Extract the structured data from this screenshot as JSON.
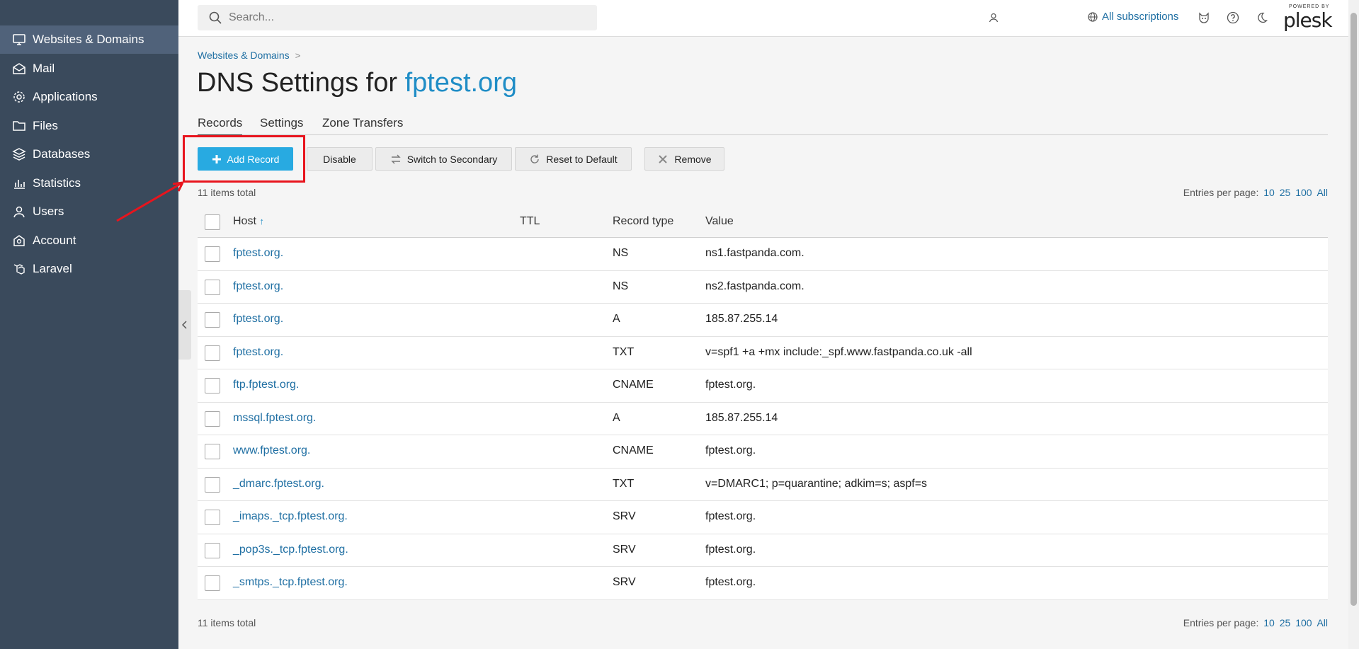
{
  "sidebar": {
    "items": [
      {
        "label": "Websites & Domains",
        "icon": "monitor-icon"
      },
      {
        "label": "Mail",
        "icon": "mail-icon"
      },
      {
        "label": "Applications",
        "icon": "gear-icon"
      },
      {
        "label": "Files",
        "icon": "folder-icon"
      },
      {
        "label": "Databases",
        "icon": "database-icon"
      },
      {
        "label": "Statistics",
        "icon": "bar-chart-icon"
      },
      {
        "label": "Users",
        "icon": "user-icon"
      },
      {
        "label": "Account",
        "icon": "account-icon"
      },
      {
        "label": "Laravel",
        "icon": "laravel-icon"
      }
    ]
  },
  "header": {
    "search_placeholder": "Search...",
    "subscriptions_label": "All subscriptions",
    "logo_powered": "POWERED BY",
    "logo_name": "plesk"
  },
  "breadcrumb": {
    "item": "Websites & Domains"
  },
  "page": {
    "title_prefix": "DNS Settings for",
    "domain": "fptest.org"
  },
  "tabs": [
    "Records",
    "Settings",
    "Zone Transfers"
  ],
  "toolbar": {
    "add": "Add Record",
    "disable": "Disable",
    "switch": "Switch to Secondary",
    "reset": "Reset to Default",
    "remove": "Remove"
  },
  "list_info": {
    "total": "11 items total",
    "per_page_label": "Entries per page:",
    "per_page_options": [
      "10",
      "25",
      "100",
      "All"
    ]
  },
  "table": {
    "columns": {
      "host": "Host",
      "sort_arrow": "↑",
      "ttl": "TTL",
      "type": "Record type",
      "value": "Value"
    },
    "rows": [
      {
        "host": "fptest.org.",
        "ttl": "",
        "type": "NS",
        "value": "ns1.fastpanda.com."
      },
      {
        "host": "fptest.org.",
        "ttl": "",
        "type": "NS",
        "value": "ns2.fastpanda.com."
      },
      {
        "host": "fptest.org.",
        "ttl": "",
        "type": "A",
        "value": "185.87.255.14"
      },
      {
        "host": "fptest.org.",
        "ttl": "",
        "type": "TXT",
        "value": "v=spf1 +a +mx include:_spf.www.fastpanda.co.uk -all"
      },
      {
        "host": "ftp.fptest.org.",
        "ttl": "",
        "type": "CNAME",
        "value": "fptest.org."
      },
      {
        "host": "mssql.fptest.org.",
        "ttl": "",
        "type": "A",
        "value": "185.87.255.14"
      },
      {
        "host": "www.fptest.org.",
        "ttl": "",
        "type": "CNAME",
        "value": "fptest.org."
      },
      {
        "host": "_dmarc.fptest.org.",
        "ttl": "",
        "type": "TXT",
        "value": "v=DMARC1; p=quarantine; adkim=s; aspf=s"
      },
      {
        "host": "_imaps._tcp.fptest.org.",
        "ttl": "",
        "type": "SRV",
        "value": "fptest.org."
      },
      {
        "host": "_pop3s._tcp.fptest.org.",
        "ttl": "",
        "type": "SRV",
        "value": "fptest.org."
      },
      {
        "host": "_smtps._tcp.fptest.org.",
        "ttl": "",
        "type": "SRV",
        "value": "fptest.org."
      }
    ]
  },
  "colors": {
    "sidebar": "#3a4a5c",
    "accent": "#28aae1",
    "link": "#1f6fa3",
    "highlight": "#e8141d"
  }
}
